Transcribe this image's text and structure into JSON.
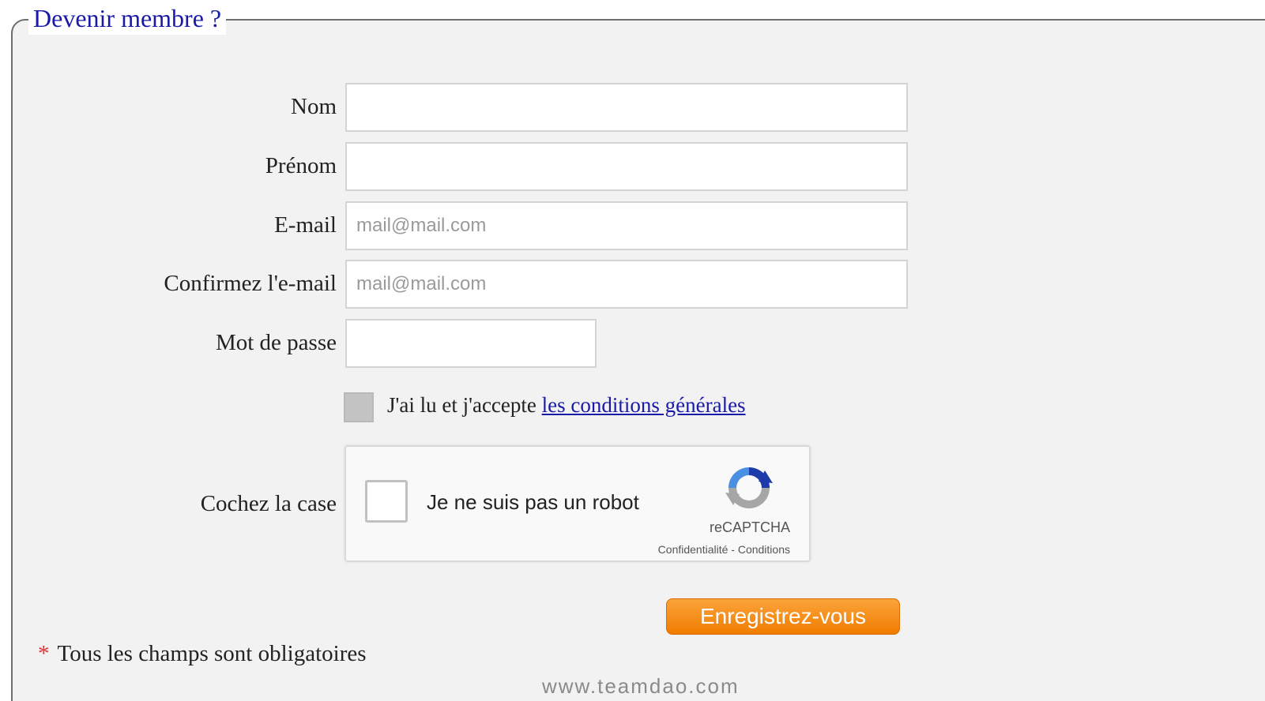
{
  "form": {
    "legend": "Devenir membre ?",
    "fields": [
      {
        "label": "Nom",
        "value": "",
        "placeholder": ""
      },
      {
        "label": "Prénom",
        "value": "",
        "placeholder": ""
      },
      {
        "label": "E-mail",
        "value": "",
        "placeholder": "mail@mail.com"
      },
      {
        "label": "Confirmez l'e-mail",
        "value": "",
        "placeholder": "mail@mail.com"
      },
      {
        "label": "Mot de passe",
        "value": "",
        "placeholder": ""
      }
    ],
    "terms": {
      "text": "J'ai lu et j'accepte ",
      "link": "les conditions générales",
      "checked": false
    },
    "captcha": {
      "label": "Cochez la case",
      "text": "Je ne suis pas un robot",
      "brand": "reCAPTCHA",
      "legal": "Confidentialité - Conditions",
      "icon": "recaptcha-logo-icon"
    },
    "submit_label": "Enregistrez-vous",
    "required_marker": "*",
    "required_note": "Tous les champs sont obligatoires"
  },
  "watermark": "www.teamdao.com",
  "colors": {
    "legend": "#1a1aa8",
    "link": "#1a1aa8",
    "button": "#f07d00",
    "asterisk": "#e03030",
    "panel": "#f2f2f2"
  }
}
